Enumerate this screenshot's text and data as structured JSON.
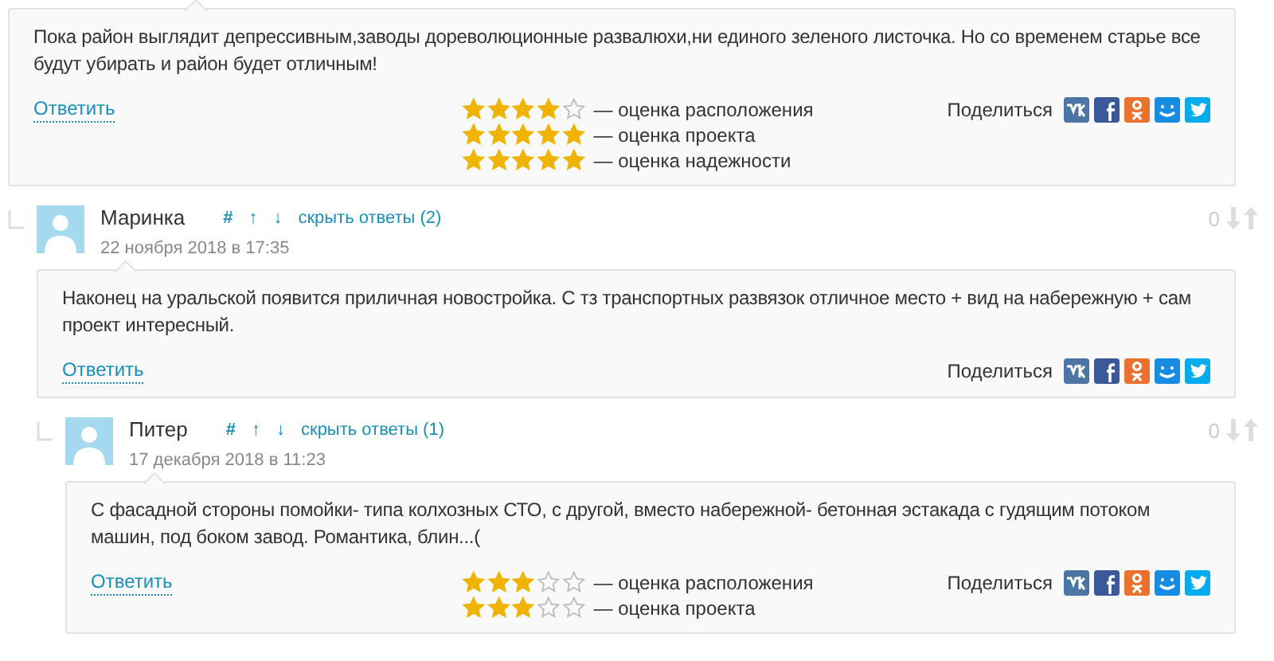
{
  "comments": [
    {
      "text": "Пока район выглядит депрессивным,заводы дореволюционные развалюхи,ни единого зеленого листочка. Но со временем старье все будут убирать и район будет отличным!",
      "reply": "Ответить",
      "ratings": [
        {
          "stars": 4,
          "label": "— оценка расположения"
        },
        {
          "stars": 5,
          "label": "— оценка проекта"
        },
        {
          "stars": 5,
          "label": "— оценка надежности"
        }
      ],
      "share_label": "Поделиться",
      "children": [
        {
          "author": "Маринка",
          "anchor": "#",
          "up": "↑",
          "down": "↓",
          "toggle": "скрыть ответы (2)",
          "date": "22 ноября 2018 в 17:35",
          "score": "0",
          "text": "Наконец на уральской появится приличная новостройка. С тз транспортных развязок отличное место + вид на набережную + сам проект интересный.",
          "reply": "Ответить",
          "share_label": "Поделиться",
          "children": [
            {
              "author": "Питер",
              "anchor": "#",
              "up": "↑",
              "down": "↓",
              "toggle": "скрыть ответы (1)",
              "date": "17 декабря 2018 в 11:23",
              "score": "0",
              "text": "С фасадной стороны помойки- типа колхозных СТО, с другой, вместо набережной- бетонная эстакада с гудящим потоком машин, под боком завод. Романтика, блин...(",
              "reply": "Ответить",
              "ratings": [
                {
                  "stars": 3,
                  "label": "— оценка расположения"
                },
                {
                  "stars": 3,
                  "label": "— оценка проекта"
                }
              ],
              "share_label": "Поделиться"
            }
          ]
        }
      ]
    }
  ]
}
